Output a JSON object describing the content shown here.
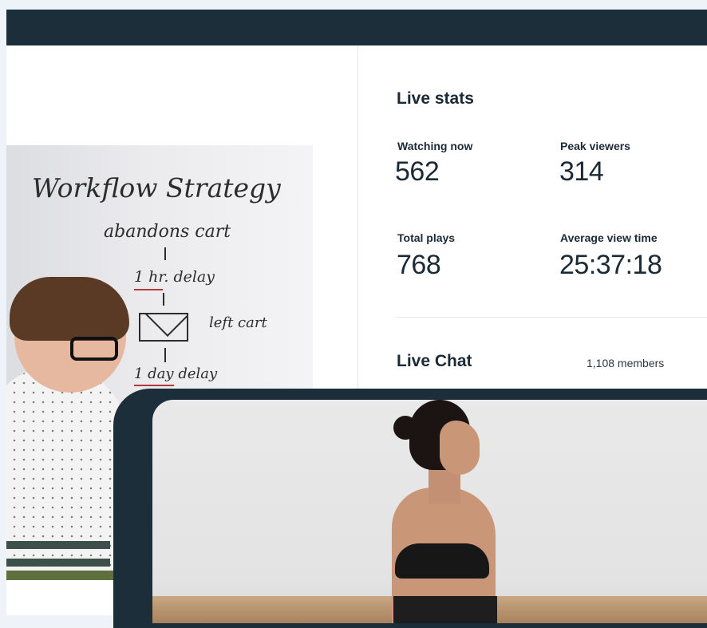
{
  "live_stats": {
    "title": "Live stats",
    "items": [
      {
        "label": "Watching now",
        "value": "562"
      },
      {
        "label": "Peak viewers",
        "value": "314"
      },
      {
        "label": "Total plays",
        "value": "768"
      },
      {
        "label": "Average view time",
        "value": "25:37:18"
      }
    ]
  },
  "live_chat": {
    "title": "Live Chat",
    "members": "1,108 members"
  },
  "whiteboard": {
    "line1": "Workflow Strategy",
    "line2": "abandons cart",
    "line3": "1 hr. delay",
    "line4": "left cart",
    "line5": "1 day delay"
  },
  "colors": {
    "navy": "#1c2e3a",
    "text": "#1b2a35",
    "background": "#edf3f8"
  }
}
